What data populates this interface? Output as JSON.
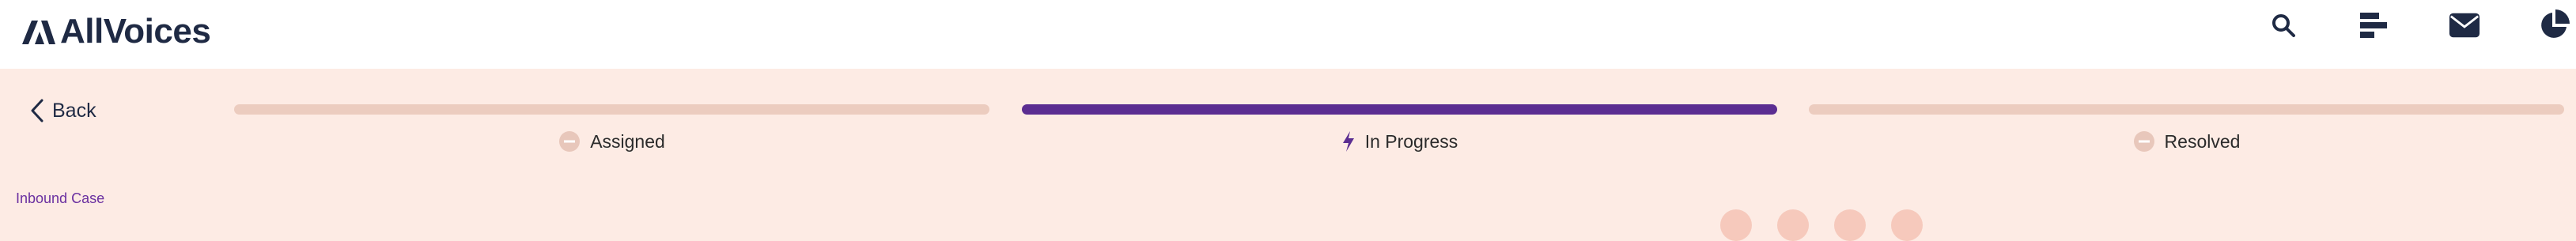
{
  "header": {
    "brand": "AllVoices",
    "icons": [
      "search-icon",
      "list-icon",
      "mail-icon",
      "pie-chart-icon"
    ]
  },
  "navigation": {
    "back_label": "Back"
  },
  "progress": {
    "steps": [
      {
        "label": "Assigned",
        "state": "pending",
        "icon": "minus-circle-icon"
      },
      {
        "label": "In Progress",
        "state": "active",
        "icon": "lightning-icon"
      },
      {
        "label": "Resolved",
        "state": "pending",
        "icon": "minus-circle-icon"
      }
    ],
    "colors": {
      "active": "#5b2d91",
      "inactive": "#ecccbf"
    }
  },
  "case": {
    "type_label": "Inbound Case"
  },
  "colors": {
    "background": "#fdebe4",
    "brand_navy": "#1f2a44",
    "accent_purple": "#6a2fa0"
  }
}
